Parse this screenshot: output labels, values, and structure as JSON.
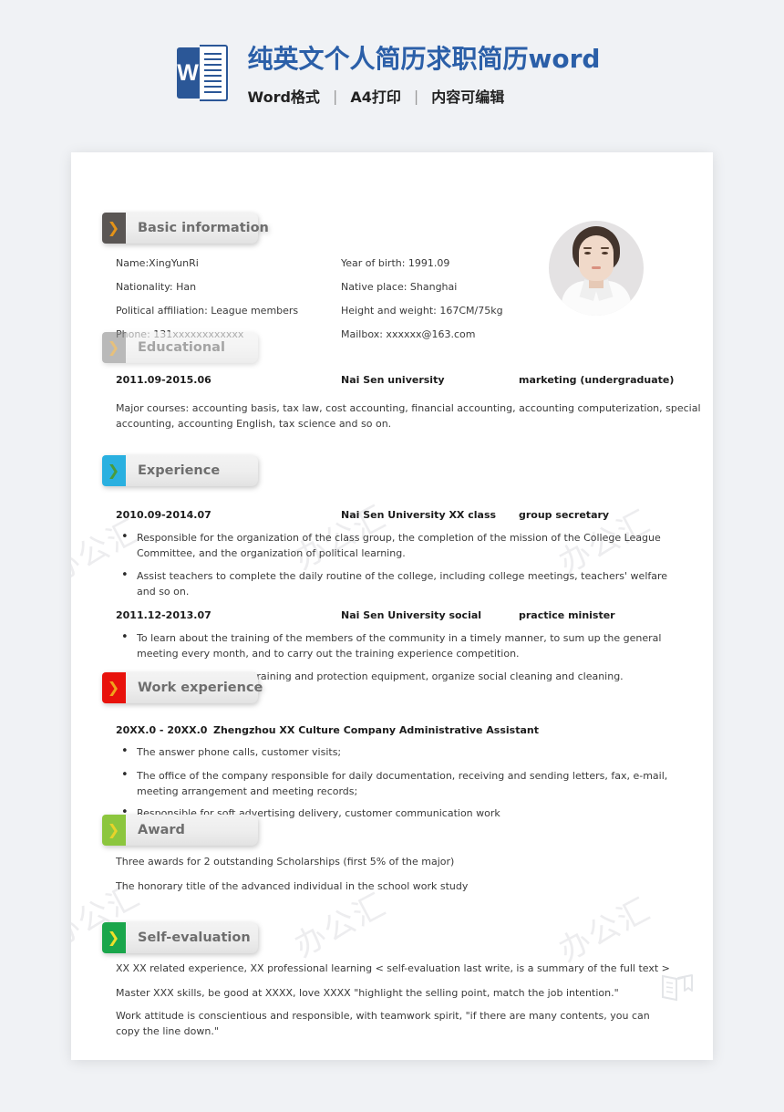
{
  "banner": {
    "logo_icon": "word-logo-icon",
    "logo_letter": "W",
    "title": "纯英文个人简历求职简历word",
    "subtitle_parts": [
      "Word格式",
      "A4打印",
      "内容可编辑"
    ],
    "separator": "|"
  },
  "watermark": {
    "text": "办公汇",
    "book_icon": "open-book-icon"
  },
  "resume": {
    "photo": {
      "icon": "portrait-photo"
    },
    "sections": [
      {
        "id": "basic-information",
        "label": "Basic information",
        "chevron_icon": "chevron-right-icon",
        "box_color": "#5a5654",
        "chevron_color": "#e59318",
        "faded": false
      },
      {
        "id": "educational",
        "label": "Educational",
        "chevron_icon": "chevron-right-icon",
        "box_color": "#8f8f8f",
        "chevron_color": "#d99b2c",
        "faded": true
      },
      {
        "id": "experience",
        "label": "Experience",
        "chevron_icon": "chevron-right-icon",
        "box_color": "#2ab0e0",
        "chevron_color": "#4a9b3c",
        "faded": false
      },
      {
        "id": "work-experience",
        "label": "Work experience",
        "chevron_icon": "chevron-right-icon",
        "box_color": "#e8120c",
        "chevron_color": "#f0a41c",
        "faded": false
      },
      {
        "id": "award",
        "label": "Award",
        "chevron_icon": "chevron-right-icon",
        "box_color": "#8cc63e",
        "chevron_color": "#e8d32a",
        "faded": false
      },
      {
        "id": "self-evaluation",
        "label": "Self-evaluation",
        "chevron_icon": "chevron-right-icon",
        "box_color": "#1aa64b",
        "chevron_color": "#f0e02a",
        "faded": false
      }
    ],
    "basic_information": {
      "left": [
        "Name:XingYunRi",
        "Nationality: Han",
        "Political affiliation: League members",
        "Phone: 131xxxxxxxxxxxx"
      ],
      "right": [
        "Year of birth: 1991.09",
        "Native place: Shanghai",
        "Height and weight: 167CM/75kg",
        "Mailbox: xxxxxx@163.com"
      ]
    },
    "educational": {
      "date": "2011.09-2015.06",
      "school": "Nai Sen university",
      "major": "marketing (undergraduate)",
      "courses_line1": "Major courses: accounting basis, tax law, cost accounting, financial accounting, accounting computerization, special",
      "courses_line2": "accounting, accounting English, tax science and so on."
    },
    "experience": [
      {
        "date": "2010.09-2014.07",
        "org": "Nai Sen University XX class",
        "role": "group secretary",
        "bullets": [
          "Responsible for the organization of the class group, the completion of the mission of the College League Committee, and the organization of political learning.",
          "Assist teachers to complete the daily routine of the college, including college meetings, teachers' welfare and so on."
        ]
      },
      {
        "date": "2011.12-2013.07",
        "org": "Nai Sen University social",
        "role": "practice minister",
        "bullets": [
          "To learn about the training of the members of the community in a timely manner, to sum up the general meeting every month, and to carry out the training experience competition.",
          "Maintain and maintain training and protection equipment, organize social cleaning and cleaning."
        ]
      }
    ],
    "work_experience": {
      "date": "20XX.0 - 20XX.0",
      "title": "Zhengzhou XX Culture Company Administrative Assistant",
      "bullets": [
        "The answer phone calls, customer visits;",
        "The office of the company responsible for daily documentation, receiving and sending letters, fax, e-mail, meeting arrangement and meeting records;",
        "Responsible for soft advertising delivery, customer communication work"
      ]
    },
    "award": [
      "Three awards for 2 outstanding Scholarships (first 5% of the major)",
      "The honorary title of the advanced individual in the school work study"
    ],
    "self_evaluation": [
      "XX XX related experience, XX professional learning < self-evaluation last write, is a summary of the full text >",
      "Master XXX skills, be good at XXXX, love XXXX \"highlight the selling point, match the job intention.\"",
      "Work attitude is conscientious and responsible, with teamwork spirit, \"if there are many contents, you can copy the line down.\""
    ]
  }
}
